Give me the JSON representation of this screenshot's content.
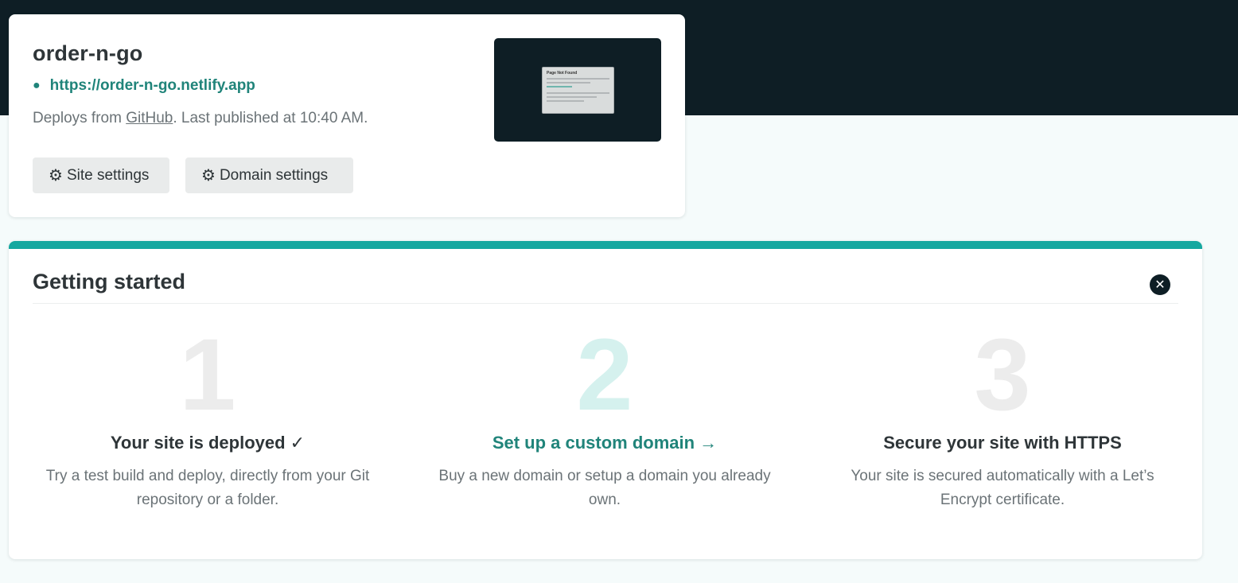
{
  "site": {
    "name": "order-n-go",
    "url": "https://order-n-go.netlify.app",
    "deploy_prefix": "Deploys from ",
    "deploy_source": "GitHub",
    "deploy_suffix": ". Last published at 10:40 AM.",
    "buttons": {
      "site_settings": "Site settings",
      "domain_settings": "Domain settings"
    },
    "gear_icon": "gear-icon",
    "preview": {
      "title": "Page Not Found"
    }
  },
  "getting_started": {
    "title": "Getting started",
    "close_icon": "close-icon",
    "accent_color": "#15a8a0",
    "steps": [
      {
        "number": "1",
        "title": "Your site is deployed ✓",
        "description": "Try a test build and deploy, directly from your Git repository or a folder."
      },
      {
        "number": "2",
        "title": "Set up a custom domain →",
        "description": "Buy a new domain or setup a domain you already own."
      },
      {
        "number": "3",
        "title": "Secure your site with HTTPS",
        "description": "Your site is secured automatically with a Let’s Encrypt certificate."
      }
    ]
  },
  "colors": {
    "header_bg": "#0e1e25",
    "link": "#20847a",
    "page_bg": "#f5fbfb"
  }
}
